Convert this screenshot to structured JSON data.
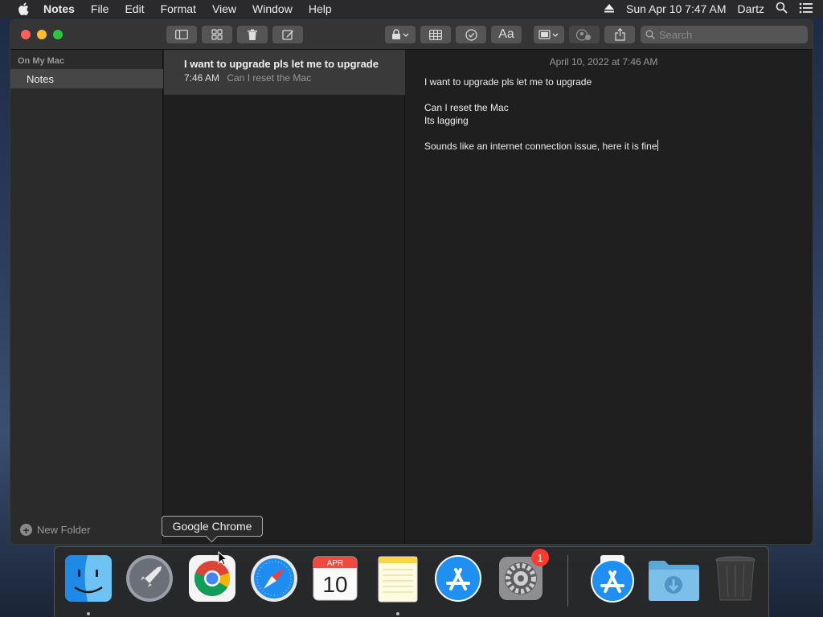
{
  "menubar": {
    "app_name": "Notes",
    "menus": [
      "File",
      "Edit",
      "Format",
      "View",
      "Window",
      "Help"
    ],
    "clock": "Sun Apr 10  7:47 AM",
    "user": "Dartz"
  },
  "toolbar": {
    "search_placeholder": "Search"
  },
  "sidebar": {
    "section_label": "On My Mac",
    "folder_label": "Notes",
    "new_folder_label": "New Folder"
  },
  "note_list": {
    "items": [
      {
        "title": "I want to upgrade pls let me to upgrade",
        "time": "7:46 AM",
        "preview": "Can I reset the Mac"
      }
    ]
  },
  "editor": {
    "date": "April 10, 2022 at 7:46 AM",
    "lines": [
      "I want to upgrade pls let me to upgrade",
      "",
      "Can I reset the Mac",
      "Its lagging",
      "",
      "Sounds like an internet connection issue, here it is fine"
    ]
  },
  "tooltip": {
    "text": "Google Chrome"
  },
  "dock": {
    "calendar_month": "APR",
    "calendar_day": "10",
    "settings_badge": "1",
    "apps": [
      "finder-icon",
      "launchpad-icon",
      "chrome-icon",
      "safari-icon",
      "calendar-icon",
      "notes-icon",
      "app-store-icon",
      "system-preferences-icon",
      "app-store-installer-icon",
      "downloads-folder-icon",
      "trash-icon"
    ]
  },
  "colors": {
    "close": "#ff5f57",
    "minimize": "#febc2e",
    "maximize": "#28c840",
    "badge": "#ff3b30",
    "selection": "#464646"
  }
}
